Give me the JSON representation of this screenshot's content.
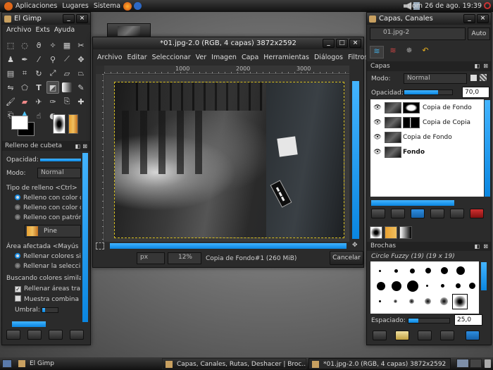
{
  "top_panel": {
    "menus": [
      "Aplicaciones",
      "Lugares",
      "Sistema"
    ],
    "clock": "dom 26 de ago. 19:39"
  },
  "toolbox": {
    "title": "El Gimp",
    "menu": [
      "Archivo",
      "Exts",
      "Ayuda"
    ],
    "tool_options_title": "Relleno de cubeta",
    "opacity_label": "Opacidad:",
    "mode_label": "Modo:",
    "mode_value": "Normal",
    "fill_type_label": "Tipo de relleno  <Ctrl>",
    "fill_options": [
      "Relleno con color d",
      "Relleno con color d",
      "Relleno con patrón"
    ],
    "pattern_name": "Pine",
    "affected_area_label": "Área afectada  <Mayús",
    "area_options": [
      "Rellenar colores si",
      "Rellenar la selecci"
    ],
    "search_label": "Buscando colores simila",
    "checks": [
      "Rellenar áreas tra",
      "Muestra combina"
    ],
    "threshold_label": "Umbral:"
  },
  "image_window": {
    "title": "*01.jpg-2.0 (RGB, 4 capas) 3872x2592",
    "menu": [
      "Archivo",
      "Editar",
      "Seleccionar",
      "Ver",
      "Imagen",
      "Capa",
      "Herramientas",
      "Diálogos",
      "Filtros"
    ],
    "ruler_ticks": [
      "1000",
      "2000",
      "3000"
    ],
    "unit": "px",
    "zoom": "12%",
    "status": "Copia de Fondo#1 (260 MiB)",
    "cancel_label": "Cancelar"
  },
  "layers_dock": {
    "title": "Capas, Canales",
    "image_select": "01.jpg-2",
    "auto_label": "Auto",
    "panel_title": "Capas",
    "mode_label": "Modo:",
    "mode_value": "Normal",
    "opacity_label": "Opacidad:",
    "opacity_value": "70,0",
    "opacity_level": 0.7,
    "layers": [
      {
        "name": "Copia de Fondo",
        "bold": false
      },
      {
        "name": "Copia de Copia",
        "bold": false
      },
      {
        "name": "Copia de Fondo",
        "bold": false
      },
      {
        "name": "Fondo",
        "bold": true
      }
    ],
    "brushes_title": "Brochas",
    "brush_name": "Circle Fuzzy (19) (19 x 19)",
    "spacing_label": "Espaciado:",
    "spacing_value": "25,0"
  },
  "taskbar": {
    "items": [
      "El Gimp",
      "Capas, Canales, Rutas, Deshacer | Broc...",
      "*01.jpg-2.0 (RGB, 4 capas) 3872x2592"
    ]
  },
  "colors": {
    "accent": "#1a8be0",
    "panel": "#2b2b2b",
    "titlebar": "#1e1e1e"
  }
}
